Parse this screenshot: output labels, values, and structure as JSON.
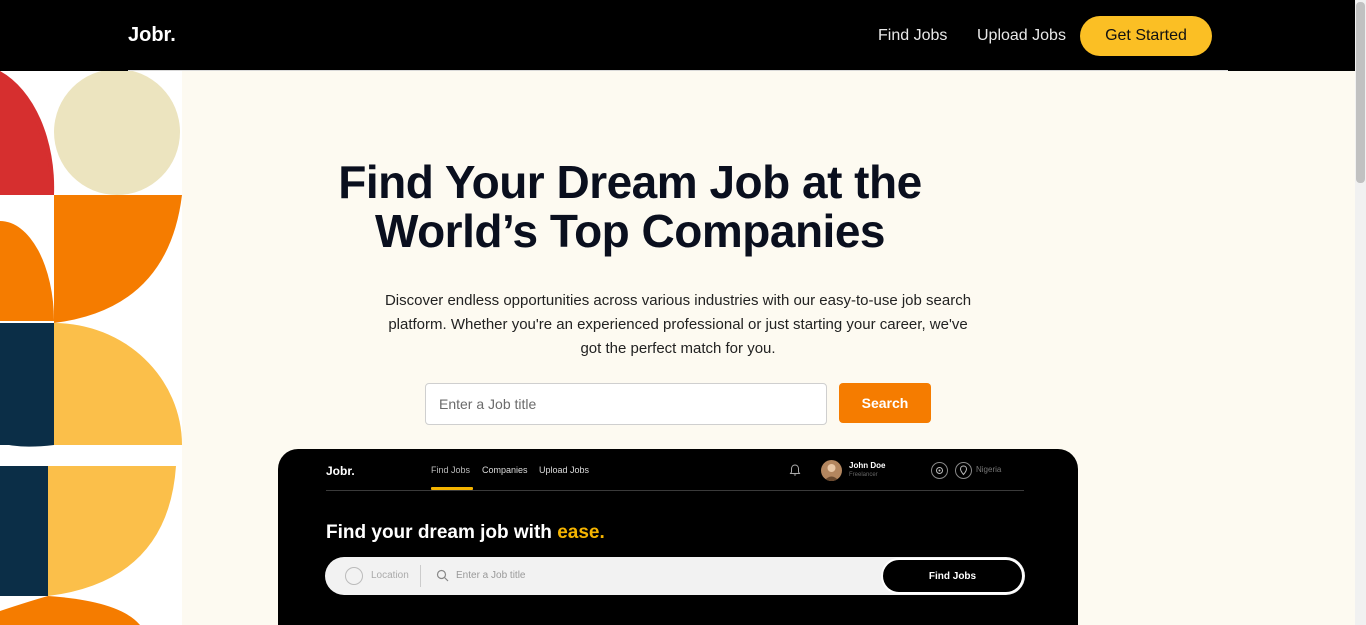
{
  "nav": {
    "logo": "Jobr.",
    "find_jobs": "Find Jobs",
    "upload_jobs": "Upload Jobs",
    "get_started": "Get Started"
  },
  "hero": {
    "title_line1": "Find Your Dream Job at the",
    "title_line2": "World’s Top Companies",
    "description": "Discover endless opportunities across various industries with our easy-to-use job search platform. Whether you're an experienced professional or just starting your career, we've got the perfect match for you.",
    "search_placeholder": "Enter a Job title",
    "search_button": "Search"
  },
  "preview": {
    "logo": "Jobr.",
    "tabs": [
      "Find Jobs",
      "Companies",
      "Upload Jobs"
    ],
    "user_name": "John Doe",
    "user_role": "Freelancer",
    "country": "Nigeria",
    "headline": "Find your dream job with ",
    "headline_accent": "ease.",
    "location_placeholder": "Location",
    "job_placeholder": "Enter a Job title",
    "find_button": "Find Jobs"
  },
  "colors": {
    "navbar": "#000000",
    "accent_yellow": "#fbbf24",
    "accent_orange": "#f57c00",
    "page_background": "#fdfaf1",
    "deco_red": "#d62f2f",
    "deco_navy": "#0b2e47",
    "deco_beige": "#ece4bf",
    "deco_gold": "#fbbf4a"
  },
  "icons": [
    "bell-icon",
    "avatar",
    "gear-icon",
    "location-pin-icon",
    "search-icon"
  ]
}
